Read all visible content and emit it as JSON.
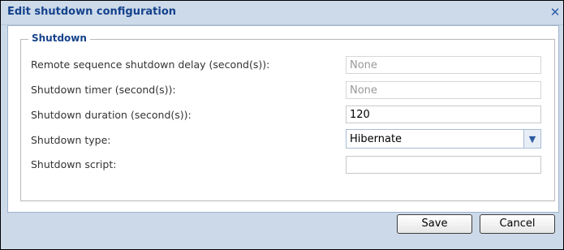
{
  "dialog": {
    "title": "Edit shutdown configuration",
    "close_glyph": "✕"
  },
  "shutdown": {
    "legend": "Shutdown",
    "fields": [
      {
        "label": "Remote sequence shutdown delay (second(s)):",
        "value": "None",
        "disabled": true
      },
      {
        "label": "Shutdown timer (second(s)):",
        "value": "None",
        "disabled": true
      },
      {
        "label": "Shutdown duration (second(s)):",
        "value": "120",
        "disabled": false
      },
      {
        "label": "Shutdown type:",
        "value": "Hibernate",
        "disabled": false
      },
      {
        "label": "Shutdown script:",
        "value": "",
        "disabled": false
      }
    ]
  },
  "footer": {
    "save_label": "Save",
    "cancel_label": "Cancel"
  }
}
